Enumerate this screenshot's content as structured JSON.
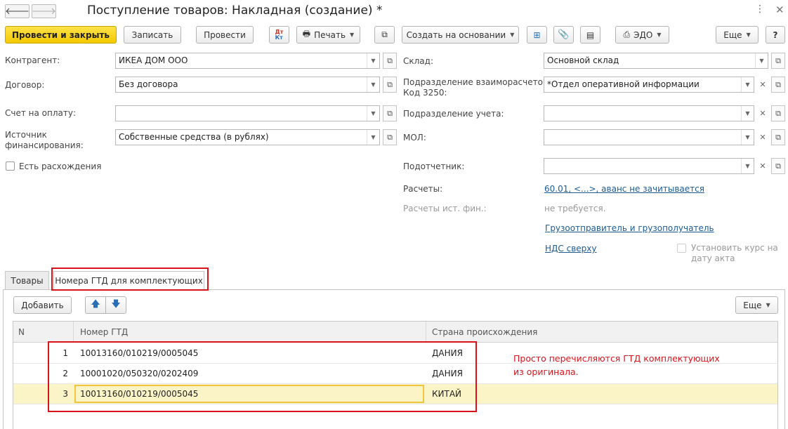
{
  "window": {
    "title": "Поступление товаров: Накладная (создание) *",
    "more_icon": "vertical-dots-icon",
    "close_icon": "close-icon"
  },
  "toolbar": {
    "post_and_close": "Провести и закрыть",
    "save": "Записать",
    "post": "Провести",
    "dtkt_top": "Дт",
    "dtkt_bottom": "Кт",
    "print": "Печать",
    "create_based_on": "Создать на основании",
    "edo": "ЭДО",
    "more": "Еще",
    "help": "?"
  },
  "form": {
    "counterparty_label": "Контрагент:",
    "counterparty_value": "ИКЕА ДОМ ООО",
    "contract_label": "Договор:",
    "contract_value": "Без договора",
    "invoice_label": "Счет на оплату:",
    "invoice_value": "",
    "funding_label_1": "Источник",
    "funding_label_2": "финансирования:",
    "funding_value": "Собственные средства (в рублях)",
    "discrepancy_label": "Есть расхождения",
    "warehouse_label": "Склад:",
    "warehouse_value": "Основной склад",
    "settlement_dept_label_1": "Подразделение взаиморасчетов",
    "settlement_dept_label_2": "Код 3250:",
    "settlement_dept_value": "*Отдел оперативной информации",
    "accounting_dept_label": "Подразделение учета:",
    "accounting_dept_value": "",
    "mol_label": "МОЛ:",
    "mol_value": "",
    "accountable_label": "Подотчетник:",
    "accountable_value": "",
    "settlements_label": "Расчеты:",
    "settlements_link": "60.01, <...>, аванс не зачитывается",
    "settlements_fin_label": "Расчеты ист. фин.:",
    "settlements_fin_value": "не требуется.",
    "consignor_link": "Грузоотправитель и грузополучатель",
    "vat_link": "НДС сверху",
    "rate_label_1": "Установить курс на",
    "rate_label_2": "дату акта"
  },
  "tabs": [
    {
      "label": "Товары",
      "active": false
    },
    {
      "label": "Номера ГТД для комплектующих",
      "active": true
    }
  ],
  "table_toolbar": {
    "add": "Добавить",
    "more": "Еще"
  },
  "table": {
    "headers": [
      "N",
      "Номер ГТД",
      "Страна происхождения"
    ],
    "rows": [
      {
        "n": "1",
        "gtd": "10013160/010219/0005045",
        "country": "ДАНИЯ"
      },
      {
        "n": "2",
        "gtd": "10001020/050320/0202409",
        "country": "ДАНИЯ"
      },
      {
        "n": "3",
        "gtd": "10013160/010219/0005045",
        "country": "КИТАЙ"
      }
    ]
  },
  "annotation": {
    "line1": "Просто перечисляются ГТД комплектующих",
    "line2": "из оригинала."
  },
  "colors": {
    "primary_button": "#f4c900",
    "link": "#1c5b94",
    "highlight": "#d9131a",
    "selected_row": "#fbf4c7"
  }
}
